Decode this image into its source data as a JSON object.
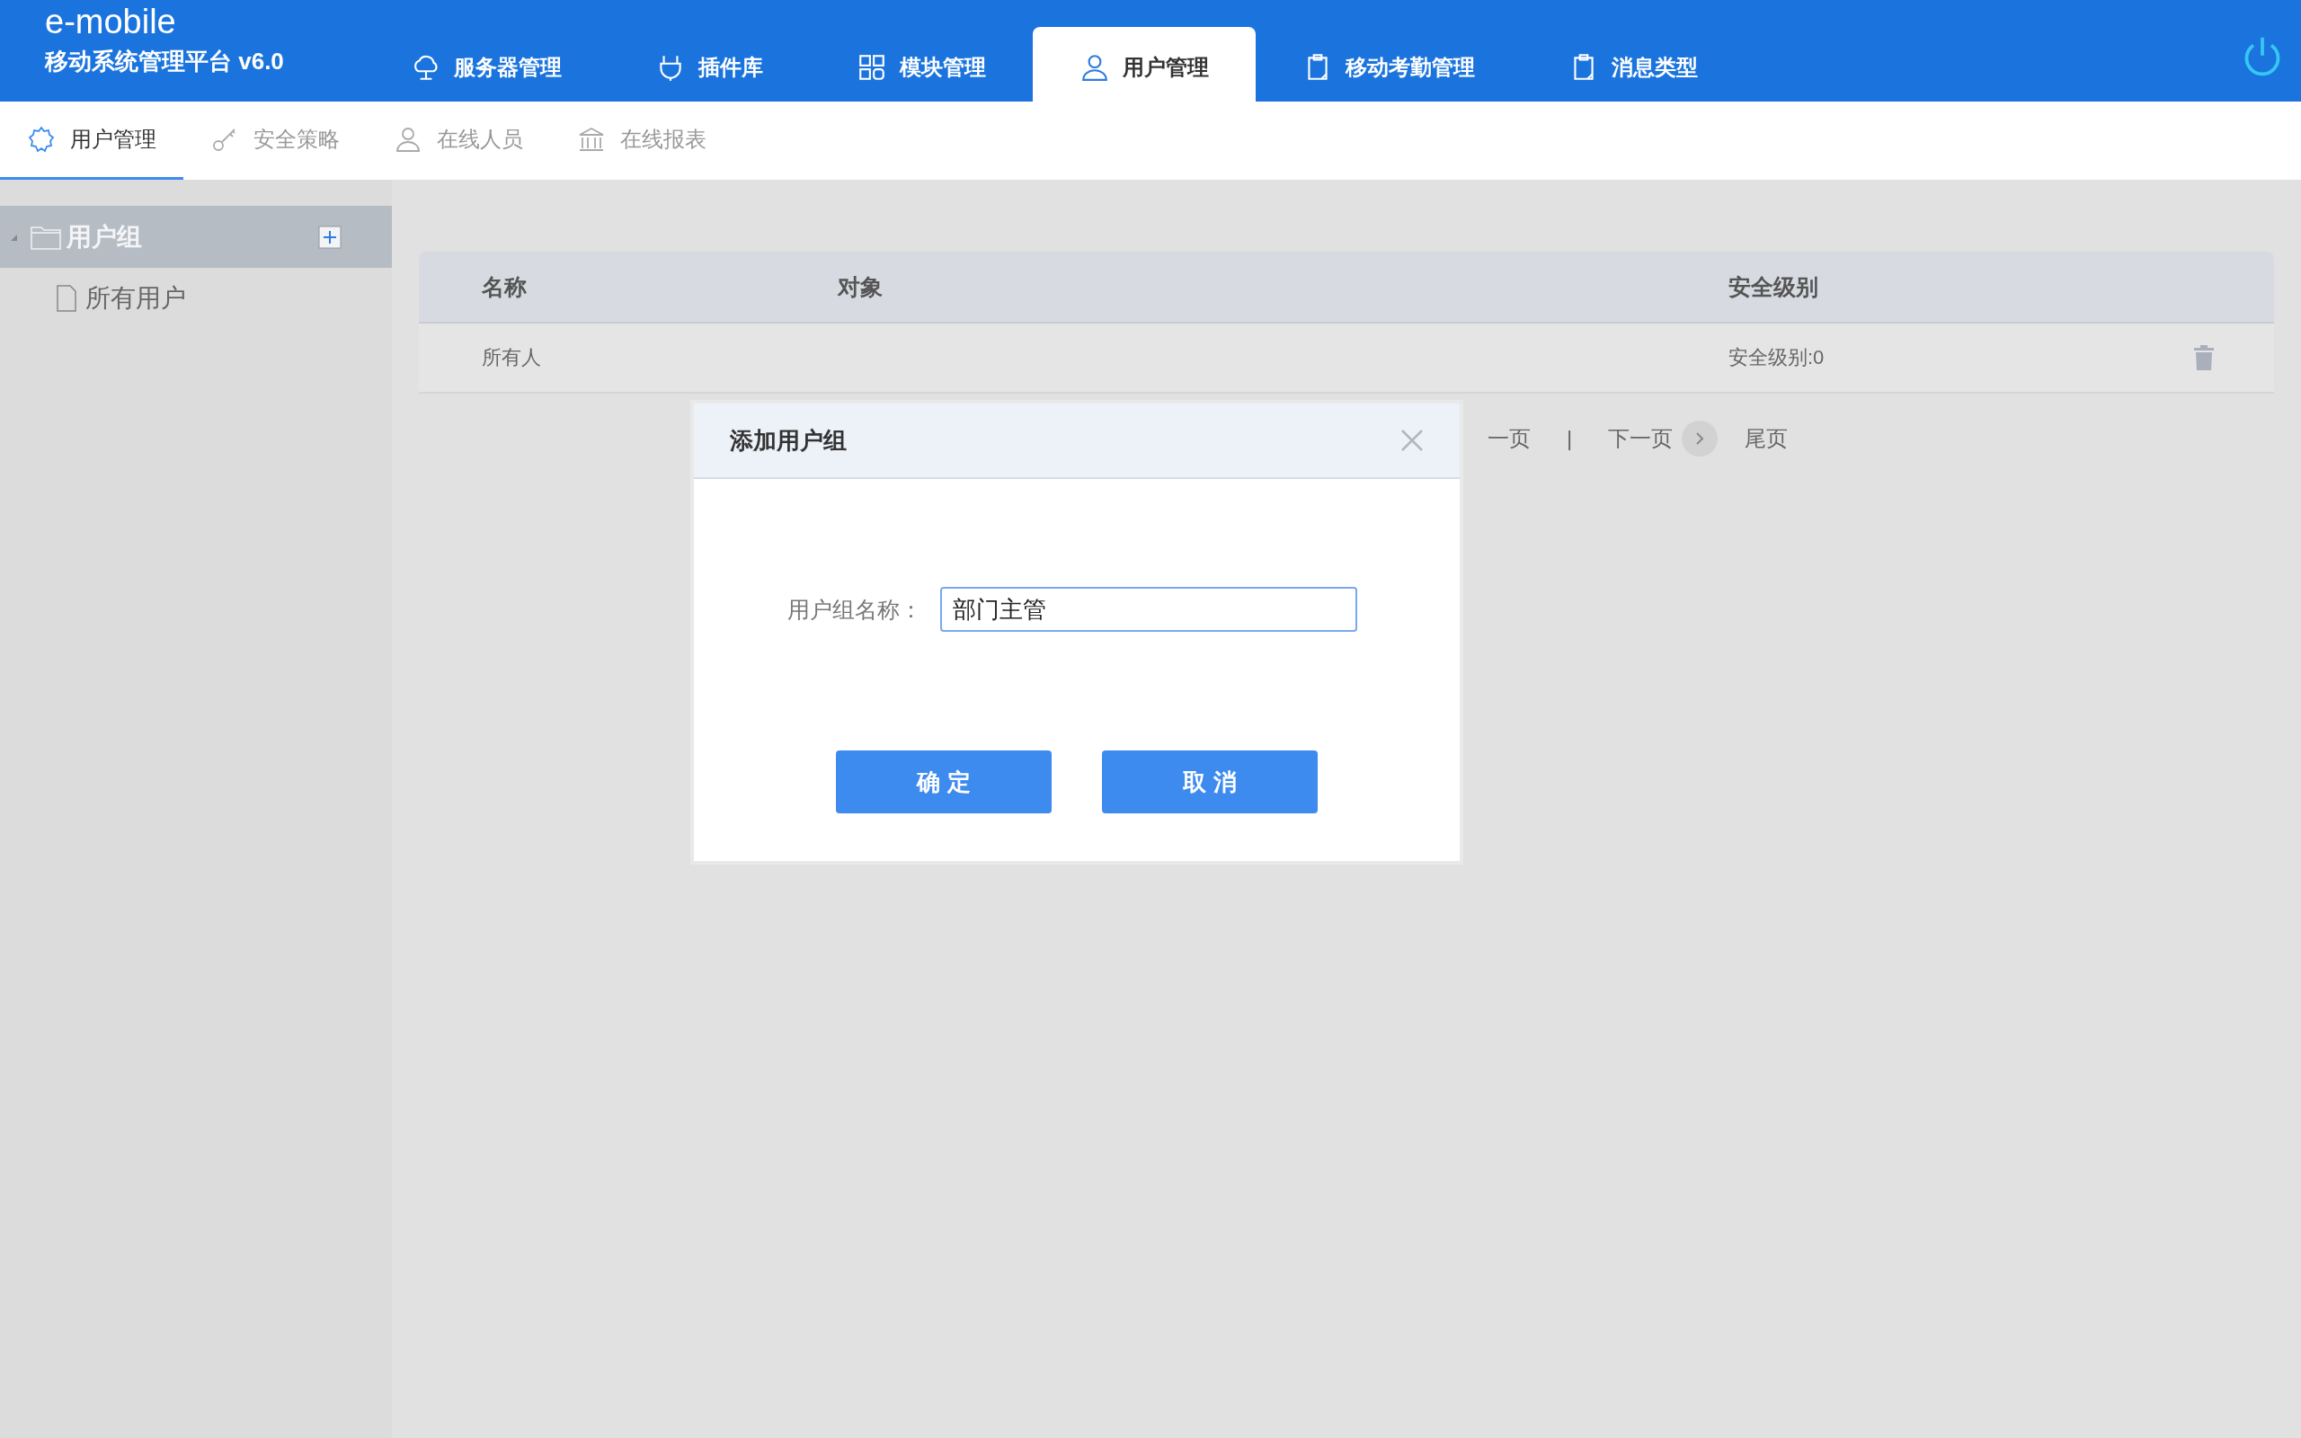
{
  "app": {
    "name": "e-mobile",
    "subtitle": "移动系统管理平台 v6.0"
  },
  "nav_tabs": [
    {
      "label": "服务器管理",
      "selected": false
    },
    {
      "label": "插件库",
      "selected": false
    },
    {
      "label": "模块管理",
      "selected": false
    },
    {
      "label": "用户管理",
      "selected": true
    },
    {
      "label": "移动考勤管理",
      "selected": false
    },
    {
      "label": "消息类型",
      "selected": false
    }
  ],
  "sub_tabs": [
    {
      "label": "用户管理",
      "selected": true
    },
    {
      "label": "安全策略",
      "selected": false
    },
    {
      "label": "在线人员",
      "selected": false
    },
    {
      "label": "在线报表",
      "selected": false
    }
  ],
  "sidebar": {
    "group": {
      "label": "用户组",
      "expanded": true,
      "children": [
        {
          "label": "所有用户"
        }
      ]
    }
  },
  "table": {
    "columns": [
      "名称",
      "对象",
      "安全级别"
    ],
    "rows": [
      {
        "name": "所有人",
        "security_level": "安全级别:0"
      }
    ]
  },
  "pagination": {
    "prev": "一页",
    "separator": "|",
    "next": "下一页",
    "last": "尾页"
  },
  "dialog": {
    "title": "添加用户组",
    "field_label": "用户组名称：",
    "field_value": "部门主管",
    "buttons": [
      "确 定",
      "取 消"
    ]
  }
}
